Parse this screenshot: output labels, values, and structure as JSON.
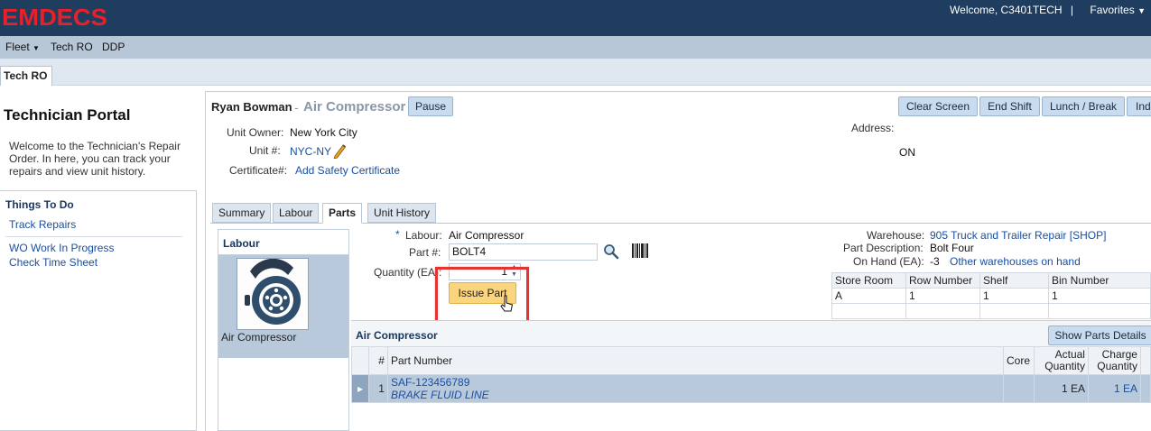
{
  "header": {
    "logo": "EMDECS",
    "welcome": "Welcome, C3401TECH",
    "separator": "|",
    "favorites": "Favorites"
  },
  "nav": {
    "fleet": "Fleet",
    "tech_ro": "Tech RO",
    "ddp": "DDP"
  },
  "tabstrip": {
    "active_tab": "Tech RO"
  },
  "portal": {
    "title": "Technician Portal",
    "description": "Welcome to the Technician's Repair Order. In here, you can track your repairs and view unit history."
  },
  "todo": {
    "title": "Things To Do",
    "links": [
      "Track Repairs",
      "WO Work In Progress",
      "Check Time Sheet"
    ]
  },
  "job": {
    "technician": "Ryan Bowman",
    "dash": "-",
    "task": "Air Compressor",
    "pause_label": "Pause",
    "unit_owner_label": "Unit Owner:",
    "unit_owner": "New York City",
    "unit_label": "Unit #:",
    "unit": "NYC-NY",
    "certificate_label": "Certificate#:",
    "certificate_link": "Add Safety Certificate",
    "address_label": "Address:",
    "province": "ON"
  },
  "actions": [
    "Clear Screen",
    "End Shift",
    "Lunch / Break",
    "Ind"
  ],
  "subtabs": [
    "Summary",
    "Labour",
    "Parts",
    "Unit History"
  ],
  "labour_panel": {
    "title": "Labour",
    "item": "Air Compressor"
  },
  "part_form": {
    "labour_star": "*",
    "labour_label": "Labour:",
    "labour_value": "Air Compressor",
    "part_label": "Part #:",
    "part_value": "BOLT4",
    "quantity_label": "Quantity (EA):",
    "quantity_value": "1",
    "issue_label": "Issue Part"
  },
  "warehouse": {
    "warehouse_label": "Warehouse:",
    "warehouse_value": "905 Truck and Trailer Repair [SHOP]",
    "desc_label": "Part Description:",
    "desc_value": "Bolt Four",
    "onhand_label": "On Hand (EA):",
    "onhand_value": "-3",
    "other_link": "Other warehouses on hand"
  },
  "store_table": {
    "headers": [
      "Store Room",
      "Row Number",
      "Shelf",
      "Bin Number"
    ],
    "rows": [
      [
        "A",
        "1",
        "1",
        "1"
      ]
    ]
  },
  "parts_grid": {
    "title": "Air Compressor",
    "show_details": "Show Parts Details",
    "headers": [
      "#",
      "Part Number",
      "Core",
      "Actual Quantity",
      "Charge Quantity"
    ],
    "rows": [
      {
        "num": "1",
        "part_number": "SAF-123456789",
        "part_desc": "BRAKE FLUID LINE",
        "core": "",
        "actual_qty": "1 EA",
        "charge_qty": "1 EA"
      }
    ]
  }
}
